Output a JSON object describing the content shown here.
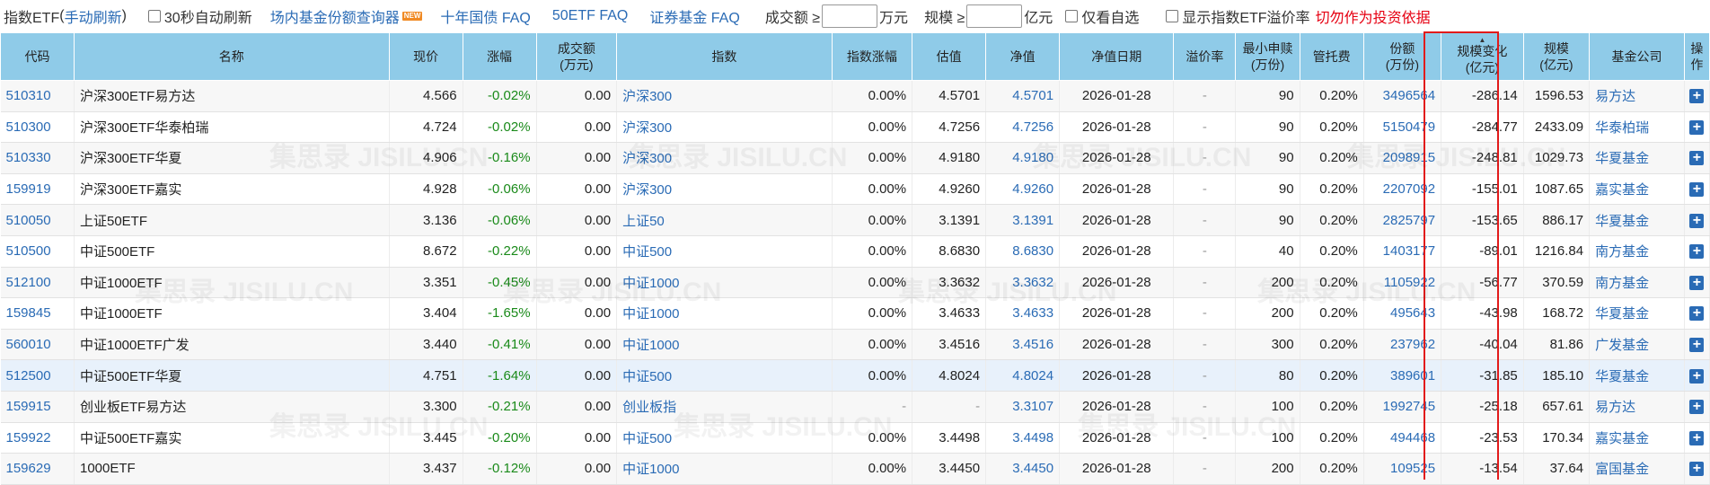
{
  "toolbar": {
    "title": "指数ETF",
    "refresh_link": "手动刷新",
    "auto_refresh_label": "30秒自动刷新",
    "fund_share_query": "场内基金份额查询器",
    "new_badge": "NEW",
    "faq_10y": "十年国债 FAQ",
    "faq_50etf": "50ETF FAQ",
    "faq_broker": "证券基金 FAQ",
    "volume_label": "成交额 ≥",
    "volume_unit": "万元",
    "scale_label": "规模 ≥",
    "scale_unit": "亿元",
    "watchlist_label": "仅看自选",
    "show_premium_label": "显示指数ETF溢价率",
    "warning": "切勿作为投资依据"
  },
  "columns": [
    {
      "l1": "代码"
    },
    {
      "l1": "名称"
    },
    {
      "l1": "现价"
    },
    {
      "l1": "涨幅"
    },
    {
      "l1": "成交额",
      "l2": "(万元)"
    },
    {
      "l1": "指数"
    },
    {
      "l1": "指数涨幅"
    },
    {
      "l1": "估值"
    },
    {
      "l1": "净值"
    },
    {
      "l1": "净值日期"
    },
    {
      "l1": "溢价率"
    },
    {
      "l1": "最小申赎",
      "l2": "(万份)"
    },
    {
      "l1": "管托费"
    },
    {
      "l1": "份额",
      "l2": "(万份)"
    },
    {
      "l1": "规模变化",
      "l2": "(亿元)"
    },
    {
      "l1": "规模",
      "l2": "(亿元)"
    },
    {
      "l1": "基金公司"
    },
    {
      "l1": "操",
      "l2": "作"
    }
  ],
  "rows": [
    [
      "510310",
      "沪深300ETF易方达",
      "4.566",
      "-0.02%",
      "0.00",
      "沪深300",
      "0.00%",
      "4.5701",
      "4.5701",
      "2026-01-28",
      "-",
      "90",
      "0.20%",
      "3496564",
      "-286.14",
      "1596.53",
      "易方达"
    ],
    [
      "510300",
      "沪深300ETF华泰柏瑞",
      "4.724",
      "-0.02%",
      "0.00",
      "沪深300",
      "0.00%",
      "4.7256",
      "4.7256",
      "2026-01-28",
      "-",
      "90",
      "0.20%",
      "5150479",
      "-284.77",
      "2433.09",
      "华泰柏瑞"
    ],
    [
      "510330",
      "沪深300ETF华夏",
      "4.906",
      "-0.16%",
      "0.00",
      "沪深300",
      "0.00%",
      "4.9180",
      "4.9180",
      "2026-01-28",
      "-",
      "90",
      "0.20%",
      "2098915",
      "-248.81",
      "1029.73",
      "华夏基金"
    ],
    [
      "159919",
      "沪深300ETF嘉实",
      "4.928",
      "-0.06%",
      "0.00",
      "沪深300",
      "0.00%",
      "4.9260",
      "4.9260",
      "2026-01-28",
      "-",
      "90",
      "0.20%",
      "2207092",
      "-155.01",
      "1087.65",
      "嘉实基金"
    ],
    [
      "510050",
      "上证50ETF",
      "3.136",
      "-0.06%",
      "0.00",
      "上证50",
      "0.00%",
      "3.1391",
      "3.1391",
      "2026-01-28",
      "-",
      "90",
      "0.20%",
      "2825797",
      "-153.65",
      "886.17",
      "华夏基金"
    ],
    [
      "510500",
      "中证500ETF",
      "8.672",
      "-0.22%",
      "0.00",
      "中证500",
      "0.00%",
      "8.6830",
      "8.6830",
      "2026-01-28",
      "-",
      "40",
      "0.20%",
      "1403177",
      "-89.01",
      "1216.84",
      "南方基金"
    ],
    [
      "512100",
      "中证1000ETF",
      "3.351",
      "-0.45%",
      "0.00",
      "中证1000",
      "0.00%",
      "3.3632",
      "3.3632",
      "2026-01-28",
      "-",
      "200",
      "0.20%",
      "1105922",
      "-56.77",
      "370.59",
      "南方基金"
    ],
    [
      "159845",
      "中证1000ETF",
      "3.404",
      "-1.65%",
      "0.00",
      "中证1000",
      "0.00%",
      "3.4633",
      "3.4633",
      "2026-01-28",
      "-",
      "200",
      "0.20%",
      "495643",
      "-43.98",
      "168.72",
      "华夏基金"
    ],
    [
      "560010",
      "中证1000ETF广发",
      "3.440",
      "-0.41%",
      "0.00",
      "中证1000",
      "0.00%",
      "3.4516",
      "3.4516",
      "2026-01-28",
      "-",
      "300",
      "0.20%",
      "237962",
      "-40.04",
      "81.86",
      "广发基金"
    ],
    [
      "512500",
      "中证500ETF华夏",
      "4.751",
      "-1.64%",
      "0.00",
      "中证500",
      "0.00%",
      "4.8024",
      "4.8024",
      "2026-01-28",
      "-",
      "80",
      "0.20%",
      "389601",
      "-31.85",
      "185.10",
      "华夏基金"
    ],
    [
      "159915",
      "创业板ETF易方达",
      "3.300",
      "-0.21%",
      "0.00",
      "创业板指",
      "-",
      "-",
      "3.3107",
      "2026-01-28",
      "-",
      "100",
      "0.20%",
      "1992745",
      "-25.18",
      "657.61",
      "易方达"
    ],
    [
      "159922",
      "中证500ETF嘉实",
      "3.445",
      "-0.20%",
      "0.00",
      "中证500",
      "0.00%",
      "3.4498",
      "3.4498",
      "2026-01-28",
      "-",
      "100",
      "0.20%",
      "494468",
      "-23.53",
      "170.34",
      "嘉实基金"
    ],
    [
      "159629",
      "1000ETF",
      "3.437",
      "-0.12%",
      "0.00",
      "中证1000",
      "0.00%",
      "3.4450",
      "3.4450",
      "2026-01-28",
      "-",
      "200",
      "0.20%",
      "109525",
      "-13.54",
      "37.64",
      "富国基金"
    ]
  ],
  "action_icon": "+",
  "watermark": "集思录 JISILU.CN",
  "colors": {
    "header_bg": "#8fcbe8",
    "link": "#2a6bb5",
    "negative": "#1a8a1a",
    "warning": "#e60012",
    "highlight_box": "#e21b1b"
  }
}
